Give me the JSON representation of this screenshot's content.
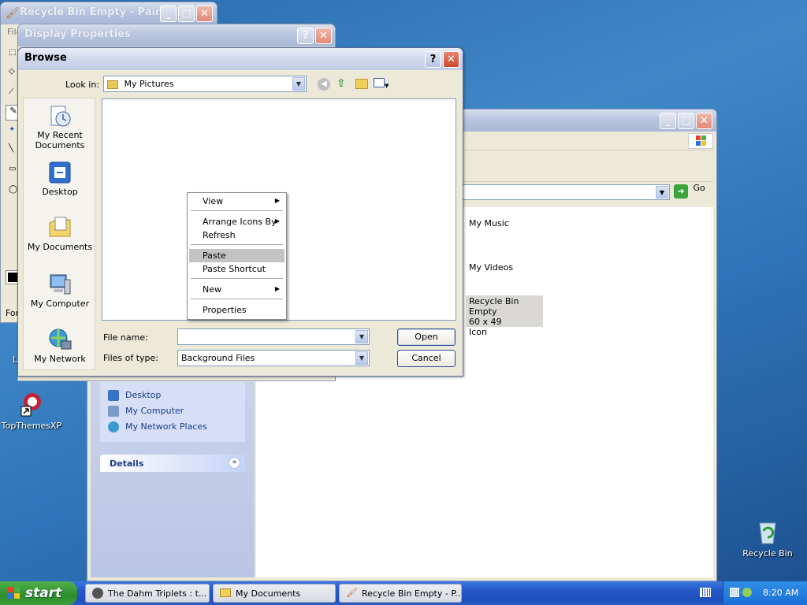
{
  "paint": {
    "title": "Recycle Bin Empty - Paint",
    "menu_file": "File",
    "status": "For"
  },
  "display_props": {
    "title": "Display Properties"
  },
  "browse": {
    "title": "Browse",
    "look_in_label": "Look in:",
    "look_in_value": "My Pictures",
    "places": [
      "My Recent Documents",
      "Desktop",
      "My Documents",
      "My Computer",
      "My Network"
    ],
    "file_name_label": "File name:",
    "file_name_value": "",
    "files_of_type_label": "Files of type:",
    "files_of_type_value": "Background Files",
    "open_label": "Open",
    "cancel_label": "Cancel"
  },
  "context_menu": {
    "items": [
      "View",
      "Arrange Icons By",
      "Refresh",
      "Paste",
      "Paste Shortcut",
      "New",
      "Properties"
    ]
  },
  "explorer": {
    "go_label": "Go",
    "items": [
      "My Music",
      "My Videos"
    ],
    "selected_item": {
      "name": "Recycle Bin Empty",
      "dims": "60 x 49",
      "type": "Icon"
    },
    "other_places": [
      "Desktop",
      "My Computer",
      "My Network Places"
    ],
    "details_label": "Details"
  },
  "desktop": {
    "topthemes_label": "TopThemesXP",
    "recycle_label": "Recycle Bin",
    "partial_label": "L"
  },
  "taskbar": {
    "start_label": "start",
    "tasks": [
      "The Dahm Triplets : t...",
      "My Documents",
      "Recycle Bin Empty - P..."
    ],
    "clock": "8:20 AM"
  }
}
